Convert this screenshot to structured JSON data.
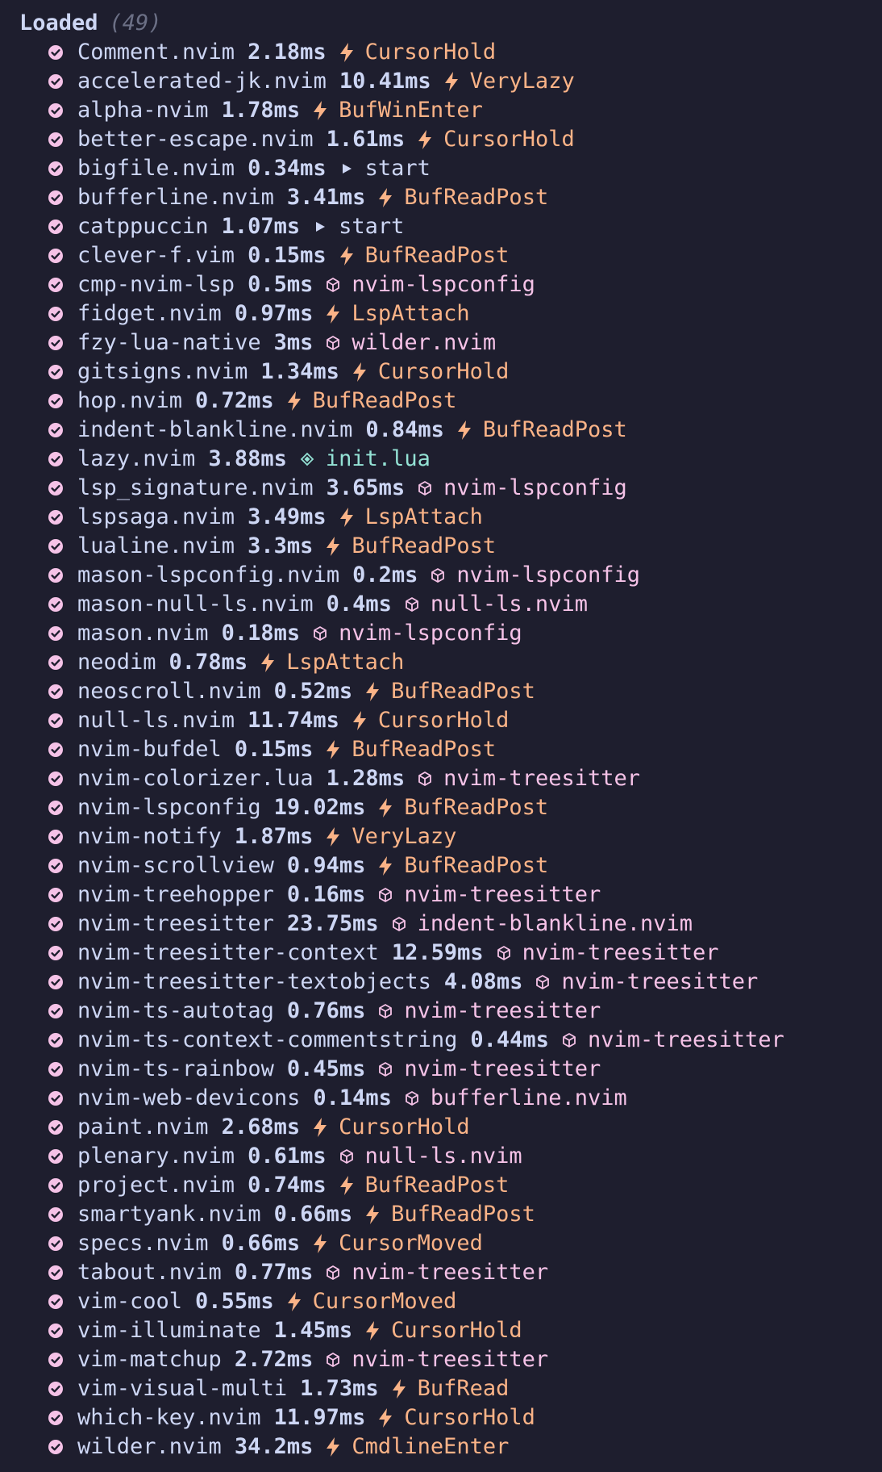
{
  "header": {
    "title": "Loaded",
    "count": "(49)"
  },
  "colors": {
    "background": "#1e1e2e",
    "text": "#cdd6f4",
    "check": "#f5c2e7",
    "event": "#fab387",
    "plugin": "#f5c2e7",
    "source": "#94e2d5",
    "muted": "#6c7086"
  },
  "icons": {
    "check": "check-circle-icon",
    "event": "lightning-bolt-icon",
    "plugin": "package-cube-icon",
    "start": "play-triangle-icon",
    "source": "diamond-icon"
  },
  "plugins": [
    {
      "name": "Comment.nvim",
      "time": "2.18ms",
      "kind": "event",
      "trigger": "CursorHold"
    },
    {
      "name": "accelerated-jk.nvim",
      "time": "10.41ms",
      "kind": "event",
      "trigger": "VeryLazy"
    },
    {
      "name": "alpha-nvim",
      "time": "1.78ms",
      "kind": "event",
      "trigger": "BufWinEnter"
    },
    {
      "name": "better-escape.nvim",
      "time": "1.61ms",
      "kind": "event",
      "trigger": "CursorHold"
    },
    {
      "name": "bigfile.nvim",
      "time": "0.34ms",
      "kind": "start",
      "trigger": "start"
    },
    {
      "name": "bufferline.nvim",
      "time": "3.41ms",
      "kind": "event",
      "trigger": "BufReadPost"
    },
    {
      "name": "catppuccin",
      "time": "1.07ms",
      "kind": "start",
      "trigger": "start"
    },
    {
      "name": "clever-f.vim",
      "time": "0.15ms",
      "kind": "event",
      "trigger": "BufReadPost"
    },
    {
      "name": "cmp-nvim-lsp",
      "time": "0.5ms",
      "kind": "plugin",
      "trigger": "nvim-lspconfig"
    },
    {
      "name": "fidget.nvim",
      "time": "0.97ms",
      "kind": "event",
      "trigger": "LspAttach"
    },
    {
      "name": "fzy-lua-native",
      "time": "3ms",
      "kind": "plugin",
      "trigger": "wilder.nvim"
    },
    {
      "name": "gitsigns.nvim",
      "time": "1.34ms",
      "kind": "event",
      "trigger": "CursorHold"
    },
    {
      "name": "hop.nvim",
      "time": "0.72ms",
      "kind": "event",
      "trigger": "BufReadPost"
    },
    {
      "name": "indent-blankline.nvim",
      "time": "0.84ms",
      "kind": "event",
      "trigger": "BufReadPost"
    },
    {
      "name": "lazy.nvim",
      "time": "3.88ms",
      "kind": "source",
      "trigger": "init.lua"
    },
    {
      "name": "lsp_signature.nvim",
      "time": "3.65ms",
      "kind": "plugin",
      "trigger": "nvim-lspconfig"
    },
    {
      "name": "lspsaga.nvim",
      "time": "3.49ms",
      "kind": "event",
      "trigger": "LspAttach"
    },
    {
      "name": "lualine.nvim",
      "time": "3.3ms",
      "kind": "event",
      "trigger": "BufReadPost"
    },
    {
      "name": "mason-lspconfig.nvim",
      "time": "0.2ms",
      "kind": "plugin",
      "trigger": "nvim-lspconfig"
    },
    {
      "name": "mason-null-ls.nvim",
      "time": "0.4ms",
      "kind": "plugin",
      "trigger": "null-ls.nvim"
    },
    {
      "name": "mason.nvim",
      "time": "0.18ms",
      "kind": "plugin",
      "trigger": "nvim-lspconfig"
    },
    {
      "name": "neodim",
      "time": "0.78ms",
      "kind": "event",
      "trigger": "LspAttach"
    },
    {
      "name": "neoscroll.nvim",
      "time": "0.52ms",
      "kind": "event",
      "trigger": "BufReadPost"
    },
    {
      "name": "null-ls.nvim",
      "time": "11.74ms",
      "kind": "event",
      "trigger": "CursorHold"
    },
    {
      "name": "nvim-bufdel",
      "time": "0.15ms",
      "kind": "event",
      "trigger": "BufReadPost"
    },
    {
      "name": "nvim-colorizer.lua",
      "time": "1.28ms",
      "kind": "plugin",
      "trigger": "nvim-treesitter"
    },
    {
      "name": "nvim-lspconfig",
      "time": "19.02ms",
      "kind": "event",
      "trigger": "BufReadPost"
    },
    {
      "name": "nvim-notify",
      "time": "1.87ms",
      "kind": "event",
      "trigger": "VeryLazy"
    },
    {
      "name": "nvim-scrollview",
      "time": "0.94ms",
      "kind": "event",
      "trigger": "BufReadPost"
    },
    {
      "name": "nvim-treehopper",
      "time": "0.16ms",
      "kind": "plugin",
      "trigger": "nvim-treesitter"
    },
    {
      "name": "nvim-treesitter",
      "time": "23.75ms",
      "kind": "plugin",
      "trigger": "indent-blankline.nvim"
    },
    {
      "name": "nvim-treesitter-context",
      "time": "12.59ms",
      "kind": "plugin",
      "trigger": "nvim-treesitter"
    },
    {
      "name": "nvim-treesitter-textobjects",
      "time": "4.08ms",
      "kind": "plugin",
      "trigger": "nvim-treesitter"
    },
    {
      "name": "nvim-ts-autotag",
      "time": "0.76ms",
      "kind": "plugin",
      "trigger": "nvim-treesitter"
    },
    {
      "name": "nvim-ts-context-commentstring",
      "time": "0.44ms",
      "kind": "plugin",
      "trigger": "nvim-treesitter"
    },
    {
      "name": "nvim-ts-rainbow",
      "time": "0.45ms",
      "kind": "plugin",
      "trigger": "nvim-treesitter"
    },
    {
      "name": "nvim-web-devicons",
      "time": "0.14ms",
      "kind": "plugin",
      "trigger": "bufferline.nvim"
    },
    {
      "name": "paint.nvim",
      "time": "2.68ms",
      "kind": "event",
      "trigger": "CursorHold"
    },
    {
      "name": "plenary.nvim",
      "time": "0.61ms",
      "kind": "plugin",
      "trigger": "null-ls.nvim"
    },
    {
      "name": "project.nvim",
      "time": "0.74ms",
      "kind": "event",
      "trigger": "BufReadPost"
    },
    {
      "name": "smartyank.nvim",
      "time": "0.66ms",
      "kind": "event",
      "trigger": "BufReadPost"
    },
    {
      "name": "specs.nvim",
      "time": "0.66ms",
      "kind": "event",
      "trigger": "CursorMoved"
    },
    {
      "name": "tabout.nvim",
      "time": "0.77ms",
      "kind": "plugin",
      "trigger": "nvim-treesitter"
    },
    {
      "name": "vim-cool",
      "time": "0.55ms",
      "kind": "event",
      "trigger": "CursorMoved"
    },
    {
      "name": "vim-illuminate",
      "time": "1.45ms",
      "kind": "event",
      "trigger": "CursorHold"
    },
    {
      "name": "vim-matchup",
      "time": "2.72ms",
      "kind": "plugin",
      "trigger": "nvim-treesitter"
    },
    {
      "name": "vim-visual-multi",
      "time": "1.73ms",
      "kind": "event",
      "trigger": "BufRead"
    },
    {
      "name": "which-key.nvim",
      "time": "11.97ms",
      "kind": "event",
      "trigger": "CursorHold"
    },
    {
      "name": "wilder.nvim",
      "time": "34.2ms",
      "kind": "event",
      "trigger": "CmdlineEnter"
    }
  ]
}
